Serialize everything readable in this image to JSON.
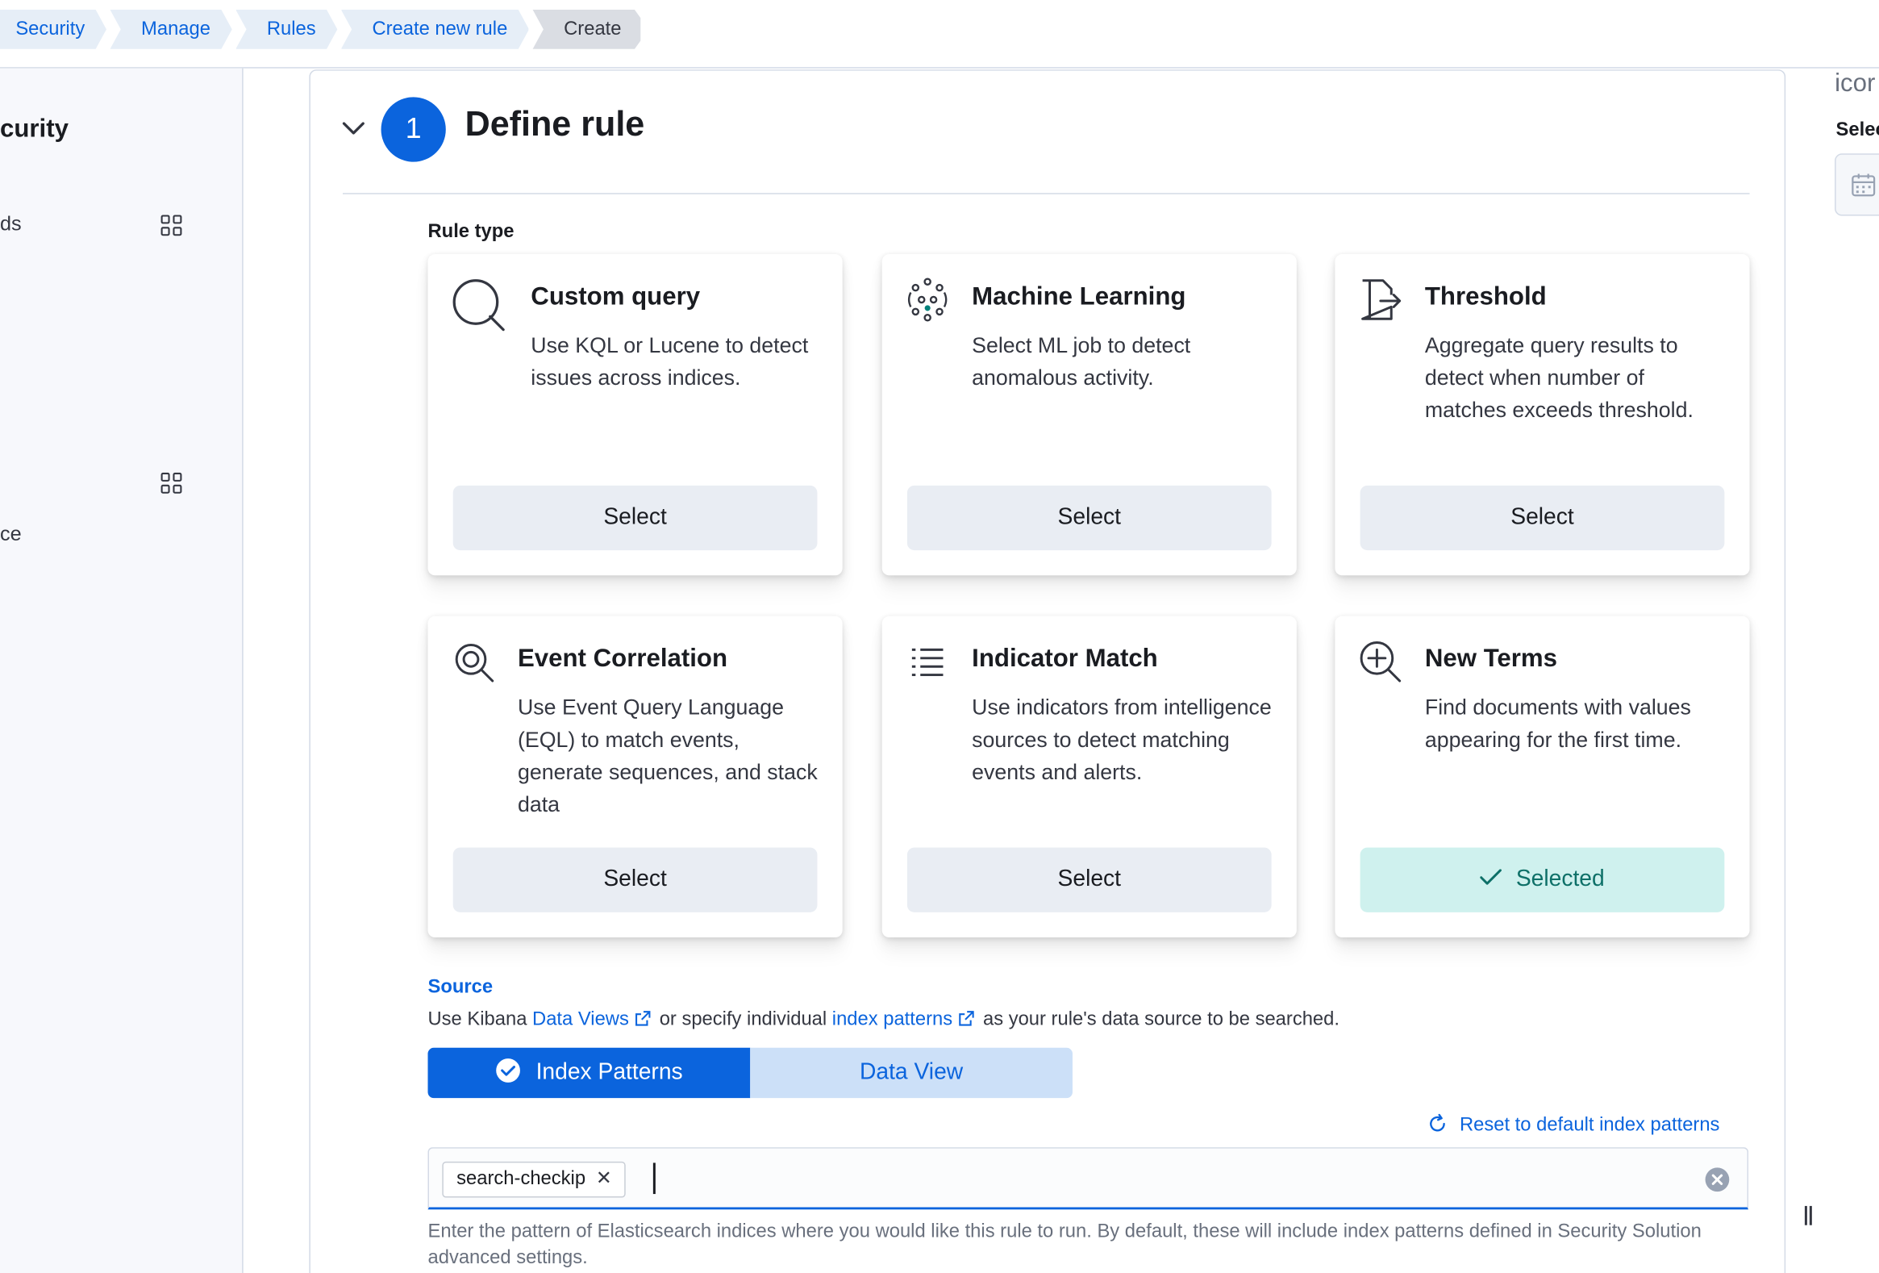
{
  "breadcrumb": [
    "Security",
    "Manage",
    "Rules",
    "Create new rule",
    "Create"
  ],
  "sidebar": {
    "title": "curity",
    "item_1": "ds",
    "item_2": "ce",
    "grid_icon": "apps-grid-icon"
  },
  "step": {
    "number": "1",
    "title": "Define rule"
  },
  "rule_type_label": "Rule type",
  "cards": [
    {
      "title": "Custom query",
      "desc": "Use KQL or Lucene to detect issues across indices.",
      "button": "Select",
      "icon": "search-icon"
    },
    {
      "title": "Machine Learning",
      "desc": "Select ML job to detect anomalous activity.",
      "button": "Select",
      "icon": "machine-learning-icon"
    },
    {
      "title": "Threshold",
      "desc": "Aggregate query results to detect when number of matches exceeds threshold.",
      "button": "Select",
      "icon": "threshold-icon"
    },
    {
      "title": "Event Correlation",
      "desc": "Use Event Query Language (EQL) to match events, generate sequences, and stack data",
      "button": "Select",
      "icon": "eql-search-icon"
    },
    {
      "title": "Indicator Match",
      "desc": "Use indicators from intelligence sources to detect matching events and alerts.",
      "button": "Select",
      "icon": "list-icon"
    },
    {
      "title": "New Terms",
      "desc": "Find documents with values appearing for the first time.",
      "button": "Selected",
      "icon": "zoom-in-icon",
      "selected": true
    }
  ],
  "source": {
    "label": "Source",
    "help_prefix": "Use Kibana",
    "link_1": "Data Views",
    "help_middle": "or specify individual",
    "link_2": "index patterns",
    "help_suffix": "as your rule's data source to be searched."
  },
  "toggle": {
    "option_1": "Index Patterns",
    "option_2": "Data View",
    "active": "Index Patterns"
  },
  "reset_link": "Reset to default index patterns",
  "index_patterns": {
    "pills": [
      "search-checkip"
    ],
    "input_value": "",
    "help": "Enter the pattern of Elasticsearch indices where you would like this rule to run. By default, these will include index patterns defined in Security Solution advanced settings."
  },
  "right_panel": {
    "text_1": "icor",
    "text_2": "Selec",
    "box_icon": "calendar-icon"
  },
  "colors": {
    "primary": "#0b64dd",
    "selected_bg": "#cff1ee",
    "selected_text": "#0e7068",
    "button_bg": "#e9edf3"
  }
}
